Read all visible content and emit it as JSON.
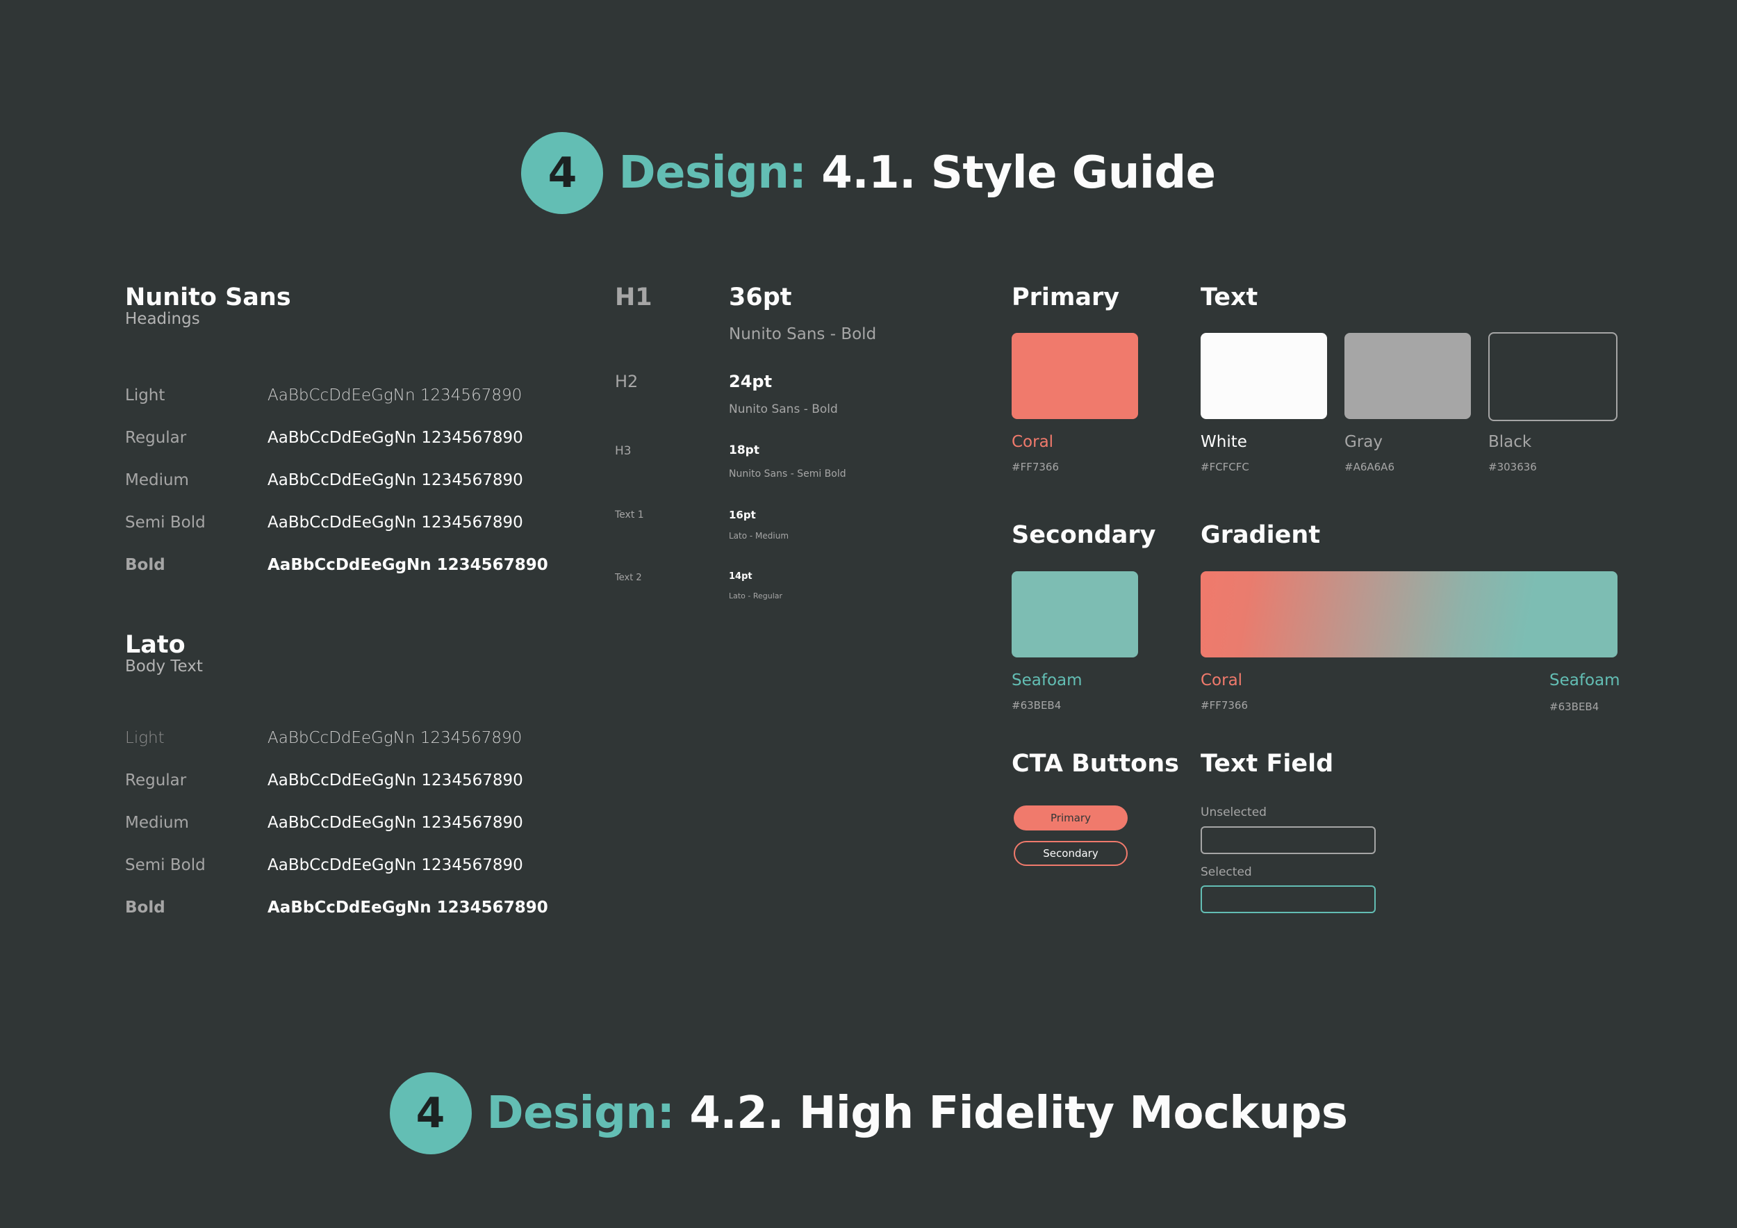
{
  "section1": {
    "number": "4",
    "accent": "Design:",
    "title": "4.1. Style Guide"
  },
  "section2": {
    "number": "4",
    "accent": "Design:",
    "title": "4.2. High Fidelity Mockups"
  },
  "fonts": [
    {
      "family": "Nunito Sans",
      "role": "Headings",
      "weights": [
        {
          "label": "Light",
          "sample": "AaBbCcDdEeGgNn 1234567890"
        },
        {
          "label": "Regular",
          "sample": "AaBbCcDdEeGgNn 1234567890"
        },
        {
          "label": "Medium",
          "sample": "AaBbCcDdEeGgNn 1234567890"
        },
        {
          "label": "Semi Bold",
          "sample": "AaBbCcDdEeGgNn 1234567890"
        },
        {
          "label": "Bold",
          "sample": "AaBbCcDdEeGgNn 1234567890"
        }
      ]
    },
    {
      "family": "Lato",
      "role": "Body Text",
      "weights": [
        {
          "label": "Light",
          "sample": "AaBbCcDdEeGgNn 1234567890"
        },
        {
          "label": "Regular",
          "sample": "AaBbCcDdEeGgNn 1234567890"
        },
        {
          "label": "Medium",
          "sample": "AaBbCcDdEeGgNn 1234567890"
        },
        {
          "label": "Semi Bold",
          "sample": "AaBbCcDdEeGgNn 1234567890"
        },
        {
          "label": "Bold",
          "sample": "AaBbCcDdEeGgNn 1234567890"
        }
      ]
    }
  ],
  "type_scale": [
    {
      "level": "H1",
      "size": "36pt",
      "font": "Nunito Sans - Bold"
    },
    {
      "level": "H2",
      "size": "24pt",
      "font": "Nunito Sans - Bold"
    },
    {
      "level": "H3",
      "size": "18pt",
      "font": "Nunito Sans - Semi Bold"
    },
    {
      "level": "Text 1",
      "size": "16pt",
      "font": "Lato - Medium"
    },
    {
      "level": "Text 2",
      "size": "14pt",
      "font": "Lato - Regular"
    }
  ],
  "palette": {
    "primary": {
      "title": "Primary",
      "name": "Coral",
      "hex": "#FF7366",
      "color": "#F07A6C"
    },
    "text": {
      "title": "Text",
      "swatches": [
        {
          "name": "White",
          "hex": "#FCFCFC",
          "color": "#FCFCFC"
        },
        {
          "name": "Gray",
          "hex": "#A6A6A6",
          "color": "#A6A6A6"
        },
        {
          "name": "Black",
          "hex": "#303636",
          "color": "#303636"
        }
      ]
    },
    "secondary": {
      "title": "Secondary",
      "name": "Seafoam",
      "hex": "#63BEB4",
      "color": "#7DBDB3"
    },
    "gradient": {
      "title": "Gradient",
      "start": {
        "name": "Coral",
        "hex": "#FF7366",
        "color": "#F07A6C"
      },
      "end": {
        "name": "Seafoam",
        "hex": "#63BEB4",
        "color": "#7DBDB3"
      }
    }
  },
  "cta": {
    "title": "CTA Buttons",
    "primary_label": "Primary",
    "secondary_label": "Secondary"
  },
  "text_field": {
    "title": "Text Field",
    "unselected_label": "Unselected",
    "selected_label": "Selected"
  },
  "colors": {
    "background": "#303636",
    "accent": "#63BEB4",
    "coral": "#F07A6C",
    "white": "#FCFCFC",
    "gray": "#A6A6A6"
  }
}
